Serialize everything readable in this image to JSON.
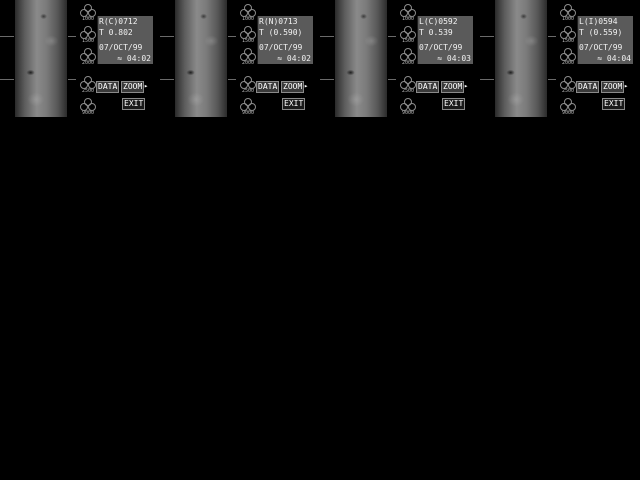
{
  "panels": [
    {
      "id": "R(C)0712",
      "value": "T  0.802",
      "date": "07/OCT/99",
      "time": "≈ 04:02"
    },
    {
      "id": "R(N)0713",
      "value": "T (0.590)",
      "date": "07/OCT/99",
      "time": "≈ 04:02"
    },
    {
      "id": "L(C)0592",
      "value": "T  0.539",
      "date": "07/OCT/99",
      "time": "≈ 04:03"
    },
    {
      "id": "L(I)0594",
      "value": "T (0.559)",
      "date": "07/OCT/99",
      "time": "≈ 04:04"
    }
  ],
  "scale_labels": [
    "1000",
    "1500",
    "2000",
    "2500",
    "9000"
  ],
  "buttons": {
    "data": "DATA",
    "zoom": "ZOOM",
    "exit": "EXIT"
  },
  "icons": {
    "cursor": "▸"
  }
}
